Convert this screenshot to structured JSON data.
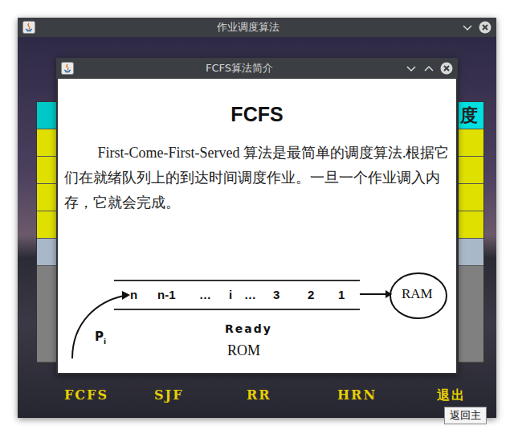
{
  "main_window": {
    "title": "作业调度算法",
    "left_cells": [
      {
        "color": "#00c8c8"
      },
      {
        "color": "#e0e000"
      },
      {
        "color": "#e0e000"
      },
      {
        "color": "#e0e000"
      },
      {
        "color": "#e0e000"
      },
      {
        "color": "#a9b8c8"
      },
      {
        "color": "#808080"
      }
    ],
    "right_cells": [
      {
        "color": "#00e0e0"
      },
      {
        "color": "#e0e000"
      },
      {
        "color": "#e0e000"
      },
      {
        "color": "#e0e000"
      },
      {
        "color": "#e0e000"
      },
      {
        "color": "#a9b8c8"
      },
      {
        "color": "#808080"
      }
    ],
    "right_header": "度",
    "menu_labels": [
      "FCFS",
      "SJF",
      "RR",
      "HRN",
      "退出"
    ],
    "back_button": "返回主"
  },
  "dialog": {
    "title": "FCFS算法简介",
    "heading": "FCFS",
    "paragraph": "First-Come-First-Served 算法是最简单的调度算法.根据它们在就绪队列上的到达时间调度作业。一旦一个作业调入内存，它就会完成。",
    "figure": {
      "queue": [
        "n",
        "n-1",
        "…",
        "i",
        "…",
        "3",
        "2",
        "1"
      ],
      "target": "RAM",
      "queue_label": "Ready",
      "source_label": "ROM",
      "process": "P",
      "process_sub": "i"
    }
  }
}
